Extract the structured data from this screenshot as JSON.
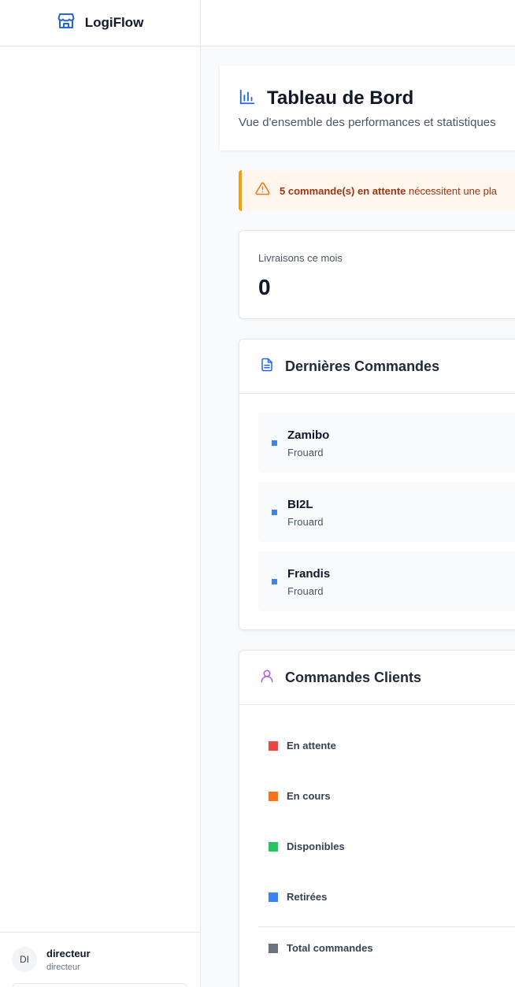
{
  "app": {
    "name": "LogiFlow",
    "icon": "store-icon"
  },
  "user": {
    "initials": "DI",
    "name": "directeur",
    "role": "directeur"
  },
  "header": {
    "icon": "bar-chart-icon",
    "title": "Tableau de Bord",
    "subtitle": "Vue d'ensemble des performances et statistiques"
  },
  "alert": {
    "icon": "warning-triangle-icon",
    "strong": "5 commande(s) en attente",
    "text": " nécessitent une pla"
  },
  "stats": {
    "deliveries_label": "Livraisons ce mois",
    "deliveries_value": "0"
  },
  "latest_orders": {
    "icon": "document-icon",
    "title": "Dernières Commandes",
    "items": [
      {
        "name": "Zamibo",
        "city": "Frouard"
      },
      {
        "name": "BI2L",
        "city": "Frouard"
      },
      {
        "name": "Frandis",
        "city": "Frouard"
      }
    ]
  },
  "client_orders": {
    "icon": "user-icon",
    "title": "Commandes Clients",
    "statuses": [
      {
        "label": "En attente",
        "color": "#ef4444"
      },
      {
        "label": "En cours",
        "color": "#f97316"
      },
      {
        "label": "Disponibles",
        "color": "#22c55e"
      },
      {
        "label": "Retirées",
        "color": "#3b82f6"
      }
    ],
    "total_label": "Total commandes",
    "total_color": "#6b7280"
  },
  "colors": {
    "accent": "#2563eb",
    "purple_icon": "#a855f7",
    "alert_border": "#f59e0b",
    "alert_text": "#9a3412"
  }
}
